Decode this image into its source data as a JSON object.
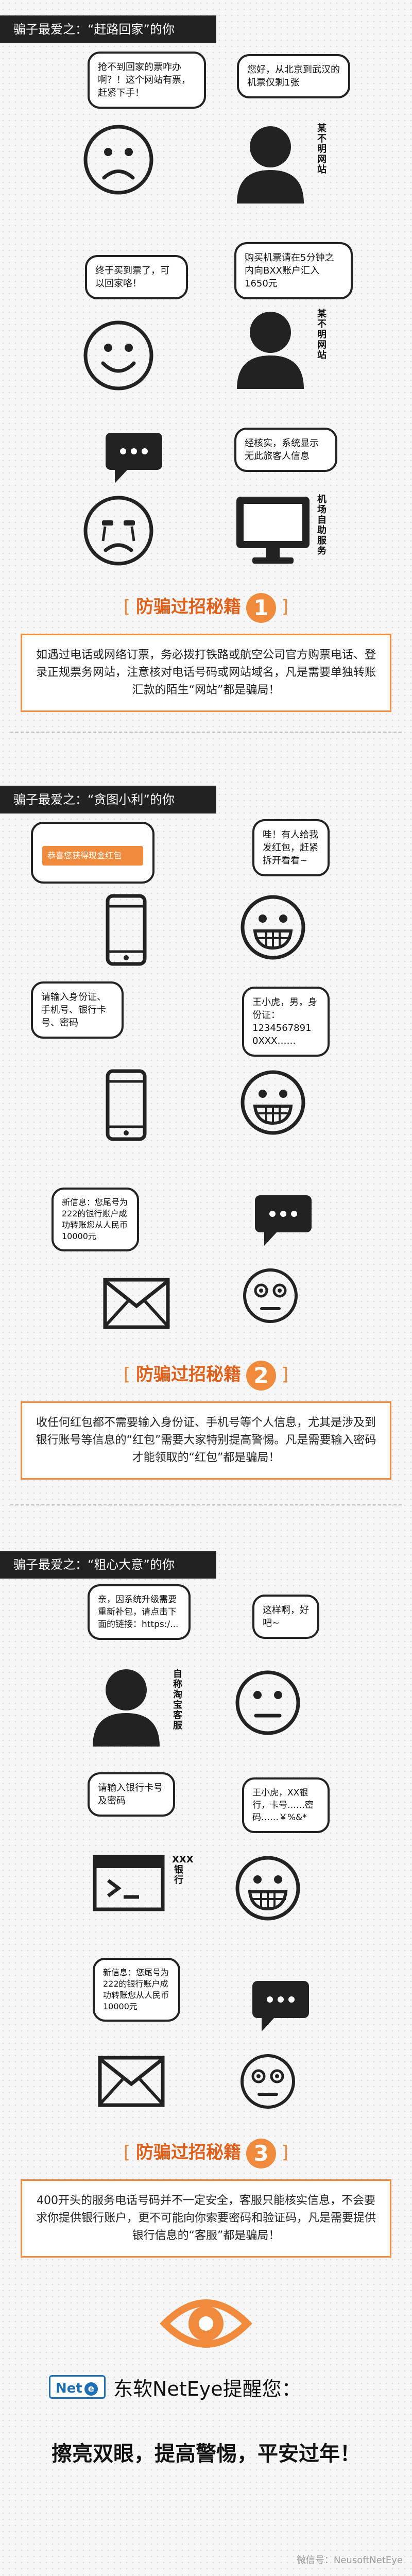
{
  "section1": {
    "banner": "骗子最爱之：“赶路回家”的你",
    "bubbles": [
      "抢不到回家的票咋办啊？！这个网站有票，赶紧下手！",
      "您好，从北京到武汉的机票仅剩1张",
      "终于买到票了，可以回家咯！",
      "购买机票请在5分钟之内向BXX账户汇入1650元",
      "经核实，系统显示无此旅客人信息"
    ],
    "caption_1": "某不明网站",
    "caption_2": "某不明网站",
    "caption_3": "机场自助服务"
  },
  "tip1": {
    "label": "防骗过招秘籍",
    "number": "1",
    "text": "如遇过电话或网络订票，务必拨打铁路或航空公司官方购票电话、登录正规票务网站，注意核对电话号码或网站域名，凡是需要单独转账汇款的陌生“网站”都是骗局！"
  },
  "section2": {
    "banner": "骗子最爱之：“贪图小利”的你",
    "phone_notice": "恭喜您获得现金红包",
    "bubbles": [
      "哇！有人给我发红包，赶紧拆开看看~",
      "请输入身份证、手机号、银行卡号、密码",
      "王小虎，男，身份证：1234567891 0XXX……",
      "新信息：您尾号为222的银行账户成功转账您从人民币10000元"
    ]
  },
  "tip2": {
    "label": "防骗过招秘籍",
    "number": "2",
    "text": "收任何红包都不需要输入身份证、手机号等个人信息，尤其是涉及到银行账号等信息的“红包”需要大家特别提高警惕。凡是需要输入密码才能领取的“红包”都是骗局！"
  },
  "section3": {
    "banner": "骗子最爱之：“粗心大意”的你",
    "bubbles": [
      "亲，因系统升级需要重新补包，请点击下面的链接：https:/...",
      "这样啊，好吧~",
      "请输入银行卡号及密码",
      "王小虎，XX银行，卡号……密码……￥%&*",
      "新信息：您尾号为222的银行账户成功转账您从人民币10000元"
    ],
    "caption_1": "自称淘宝客服",
    "caption_2": "XXX银行"
  },
  "tip3": {
    "label": "防骗过招秘籍",
    "number": "3",
    "text": "400开头的服务电话号码并不一定安全，客服只能核实信息，不会要求你提供银行账户，更不可能向你索要密码和验证码，凡是需要提供银行信息的“客服”都是骗局！"
  },
  "footer": {
    "logo_text": "Net",
    "brand": "东软NetEye提醒您：",
    "slogan": "擦亮双眼，提高警惕，平安过年！",
    "watermark": "微信号：NeusoftNetEye"
  },
  "colors": {
    "accent": "#f08a3c",
    "dark": "#222222"
  }
}
